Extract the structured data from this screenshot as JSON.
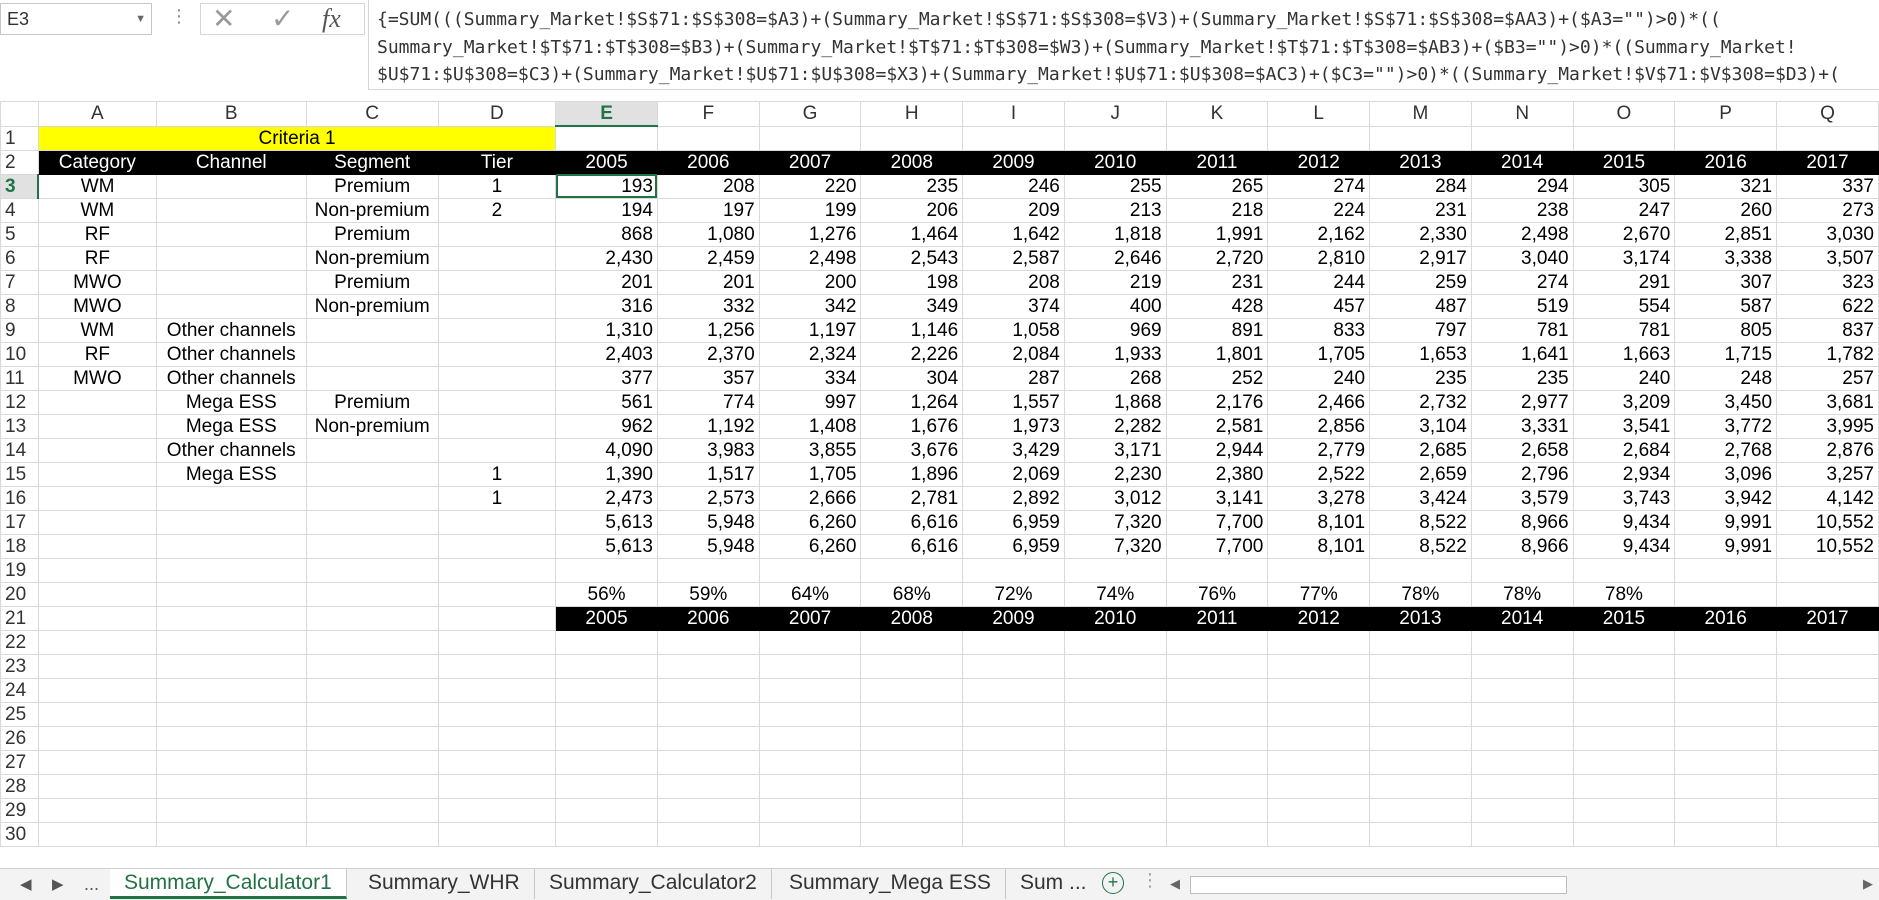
{
  "formula_bar": {
    "name_box": "E3",
    "fx_label": "fx",
    "formula_lines": [
      "{=SUM(((Summary_Market!$S$71:$S$308=$A3)+(Summary_Market!$S$71:$S$308=$V3)+(Summary_Market!$S$71:$S$308=$AA3)+($A3=\"\")>0)*((",
      "Summary_Market!$T$71:$T$308=$B3)+(Summary_Market!$T$71:$T$308=$W3)+(Summary_Market!$T$71:$T$308=$AB3)+($B3=\"\")>0)*((Summary_Market!",
      "$U$71:$U$308=$C3)+(Summary_Market!$U$71:$U$308=$X3)+(Summary_Market!$U$71:$U$308=$AC3)+($C3=\"\")>0)*((Summary_Market!$V$71:$V$308=$D3)+("
    ]
  },
  "columns": [
    "A",
    "B",
    "C",
    "D",
    "E",
    "F",
    "G",
    "H",
    "I",
    "J",
    "K",
    "L",
    "M",
    "N",
    "O",
    "P",
    "Q"
  ],
  "selected_cell": {
    "column": "E",
    "row": "3"
  },
  "sheet": {
    "criteria_label": "Criteria 1",
    "headers": [
      "Category",
      "Channel",
      "Segment",
      "Tier"
    ],
    "years": [
      "2005",
      "2006",
      "2007",
      "2008",
      "2009",
      "2010",
      "2011",
      "2012",
      "2013",
      "2014",
      "2015",
      "2016",
      "2017"
    ],
    "rows": [
      {
        "row": "3",
        "category": "WM",
        "channel": "",
        "segment": "Premium",
        "tier": "1",
        "values": [
          "193",
          "208",
          "220",
          "235",
          "246",
          "255",
          "265",
          "274",
          "284",
          "294",
          "305",
          "321",
          "337"
        ]
      },
      {
        "row": "4",
        "category": "WM",
        "channel": "",
        "segment": "Non-premium",
        "tier": "2",
        "values": [
          "194",
          "197",
          "199",
          "206",
          "209",
          "213",
          "218",
          "224",
          "231",
          "238",
          "247",
          "260",
          "273"
        ]
      },
      {
        "row": "5",
        "category": "RF",
        "channel": "",
        "segment": "Premium",
        "tier": "",
        "values": [
          "868",
          "1,080",
          "1,276",
          "1,464",
          "1,642",
          "1,818",
          "1,991",
          "2,162",
          "2,330",
          "2,498",
          "2,670",
          "2,851",
          "3,030"
        ]
      },
      {
        "row": "6",
        "category": "RF",
        "channel": "",
        "segment": "Non-premium",
        "tier": "",
        "values": [
          "2,430",
          "2,459",
          "2,498",
          "2,543",
          "2,587",
          "2,646",
          "2,720",
          "2,810",
          "2,917",
          "3,040",
          "3,174",
          "3,338",
          "3,507"
        ]
      },
      {
        "row": "7",
        "category": "MWO",
        "channel": "",
        "segment": "Premium",
        "tier": "",
        "values": [
          "201",
          "201",
          "200",
          "198",
          "208",
          "219",
          "231",
          "244",
          "259",
          "274",
          "291",
          "307",
          "323"
        ]
      },
      {
        "row": "8",
        "category": "MWO",
        "channel": "",
        "segment": "Non-premium",
        "tier": "",
        "values": [
          "316",
          "332",
          "342",
          "349",
          "374",
          "400",
          "428",
          "457",
          "487",
          "519",
          "554",
          "587",
          "622"
        ]
      },
      {
        "row": "9",
        "category": "WM",
        "channel": "Other channels",
        "segment": "",
        "tier": "",
        "values": [
          "1,310",
          "1,256",
          "1,197",
          "1,146",
          "1,058",
          "969",
          "891",
          "833",
          "797",
          "781",
          "781",
          "805",
          "837"
        ]
      },
      {
        "row": "10",
        "category": "RF",
        "channel": "Other channels",
        "segment": "",
        "tier": "",
        "values": [
          "2,403",
          "2,370",
          "2,324",
          "2,226",
          "2,084",
          "1,933",
          "1,801",
          "1,705",
          "1,653",
          "1,641",
          "1,663",
          "1,715",
          "1,782"
        ]
      },
      {
        "row": "11",
        "category": "MWO",
        "channel": "Other channels",
        "segment": "",
        "tier": "",
        "values": [
          "377",
          "357",
          "334",
          "304",
          "287",
          "268",
          "252",
          "240",
          "235",
          "235",
          "240",
          "248",
          "257"
        ]
      },
      {
        "row": "12",
        "category": "",
        "channel": "Mega ESS",
        "segment": "Premium",
        "tier": "",
        "values": [
          "561",
          "774",
          "997",
          "1,264",
          "1,557",
          "1,868",
          "2,176",
          "2,466",
          "2,732",
          "2,977",
          "3,209",
          "3,450",
          "3,681"
        ]
      },
      {
        "row": "13",
        "category": "",
        "channel": "Mega ESS",
        "segment": "Non-premium",
        "tier": "",
        "values": [
          "962",
          "1,192",
          "1,408",
          "1,676",
          "1,973",
          "2,282",
          "2,581",
          "2,856",
          "3,104",
          "3,331",
          "3,541",
          "3,772",
          "3,995"
        ]
      },
      {
        "row": "14",
        "category": "",
        "channel": "Other channels",
        "segment": "",
        "tier": "",
        "values": [
          "4,090",
          "3,983",
          "3,855",
          "3,676",
          "3,429",
          "3,171",
          "2,944",
          "2,779",
          "2,685",
          "2,658",
          "2,684",
          "2,768",
          "2,876"
        ]
      },
      {
        "row": "15",
        "category": "",
        "channel": "Mega ESS",
        "segment": "",
        "tier": "1",
        "values": [
          "1,390",
          "1,517",
          "1,705",
          "1,896",
          "2,069",
          "2,230",
          "2,380",
          "2,522",
          "2,659",
          "2,796",
          "2,934",
          "3,096",
          "3,257"
        ]
      },
      {
        "row": "16",
        "category": "",
        "channel": "",
        "segment": "",
        "tier": "1",
        "values": [
          "2,473",
          "2,573",
          "2,666",
          "2,781",
          "2,892",
          "3,012",
          "3,141",
          "3,278",
          "3,424",
          "3,579",
          "3,743",
          "3,942",
          "4,142"
        ]
      },
      {
        "row": "17",
        "category": "",
        "channel": "",
        "segment": "",
        "tier": "",
        "values": [
          "5,613",
          "5,948",
          "6,260",
          "6,616",
          "6,959",
          "7,320",
          "7,700",
          "8,101",
          "8,522",
          "8,966",
          "9,434",
          "9,991",
          "10,552"
        ]
      },
      {
        "row": "18",
        "category": "",
        "channel": "",
        "segment": "",
        "tier": "",
        "values": [
          "5,613",
          "5,948",
          "6,260",
          "6,616",
          "6,959",
          "7,320",
          "7,700",
          "8,101",
          "8,522",
          "8,966",
          "9,434",
          "9,991",
          "10,552"
        ]
      }
    ],
    "percent_row": [
      "56%",
      "59%",
      "64%",
      "68%",
      "72%",
      "74%",
      "76%",
      "77%",
      "78%",
      "78%",
      "78%",
      "",
      ""
    ],
    "empty_rows": [
      "19",
      "22",
      "23",
      "24",
      "25",
      "26",
      "27",
      "28",
      "29",
      "30"
    ],
    "row_labels": {
      "criteria": "1",
      "headers": "2",
      "percent": "20",
      "years": "21"
    }
  },
  "tabs": {
    "nav_prev": "◀",
    "nav_next": "▶",
    "nav_more": "...",
    "items": [
      {
        "label": "Summary_Calculator1",
        "active": true
      },
      {
        "label": "Summary_WHR",
        "active": false
      },
      {
        "label": "Summary_Calculator2",
        "active": false
      },
      {
        "label": "Summary_Mega ESS",
        "active": false
      },
      {
        "label": "Sum ...",
        "active": false
      }
    ],
    "add_label": "+",
    "dots": "⋮"
  }
}
